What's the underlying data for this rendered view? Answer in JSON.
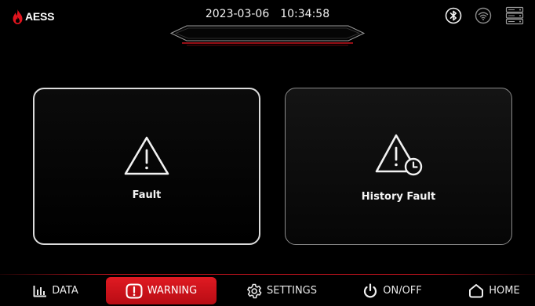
{
  "brand": {
    "name": "AESS"
  },
  "header": {
    "date": "2023-03-06",
    "time": "10:34:58"
  },
  "status_icons": [
    "bluetooth-icon",
    "wifi-icon",
    "server-icon"
  ],
  "colors": {
    "accent": "#c8141e",
    "background": "#000000",
    "tile_border": "#dcdcdc"
  },
  "tiles": [
    {
      "label": "Fault",
      "icon": "warning-triangle-icon"
    },
    {
      "label": "History Fault",
      "icon": "warning-history-icon"
    }
  ],
  "nav": [
    {
      "label": "DATA",
      "icon": "bar-chart-icon",
      "active": false
    },
    {
      "label": "WARNING",
      "icon": "warning-icon",
      "active": true
    },
    {
      "label": "SETTINGS",
      "icon": "gear-icon",
      "active": false
    },
    {
      "label": "ON/OFF",
      "icon": "power-icon",
      "active": false
    },
    {
      "label": "HOME",
      "icon": "home-icon",
      "active": false
    }
  ]
}
